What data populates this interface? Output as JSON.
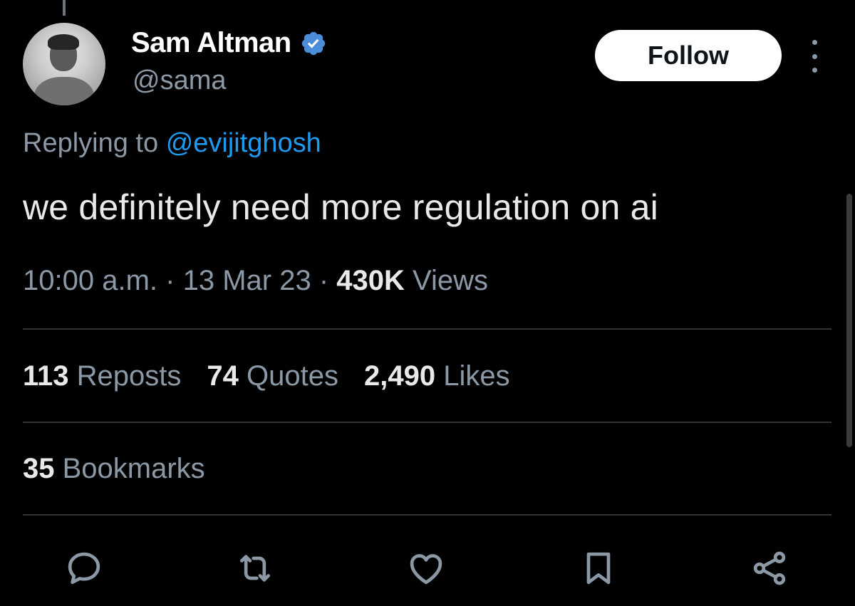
{
  "user": {
    "name": "Sam Altman",
    "handle": "@sama",
    "verified_color": "#4c8dd9"
  },
  "header": {
    "follow_label": "Follow",
    "more_icon": "more-vertical-icon"
  },
  "reply": {
    "prefix": "Replying to",
    "mention": "@evijitghosh"
  },
  "tweet": {
    "text": "we definitely need more regulation on ai"
  },
  "meta": {
    "time": "10:00 a.m.",
    "sep1": "·",
    "date": "13 Mar 23",
    "sep2": "·",
    "views_count": "430K",
    "views_label": "Views"
  },
  "stats": {
    "reposts": {
      "count": "113",
      "label": "Reposts"
    },
    "quotes": {
      "count": "74",
      "label": "Quotes"
    },
    "likes": {
      "count": "2,490",
      "label": "Likes"
    },
    "bookmarks": {
      "count": "35",
      "label": "Bookmarks"
    }
  },
  "actions": [
    {
      "name": "reply-icon"
    },
    {
      "name": "repost-icon"
    },
    {
      "name": "like-icon"
    },
    {
      "name": "bookmark-icon"
    },
    {
      "name": "share-icon"
    }
  ],
  "colors": {
    "background": "#000000",
    "text_primary": "#e7e9ea",
    "text_secondary": "#8b98a5",
    "link": "#1d9bf0",
    "divider": "#2f3336"
  }
}
